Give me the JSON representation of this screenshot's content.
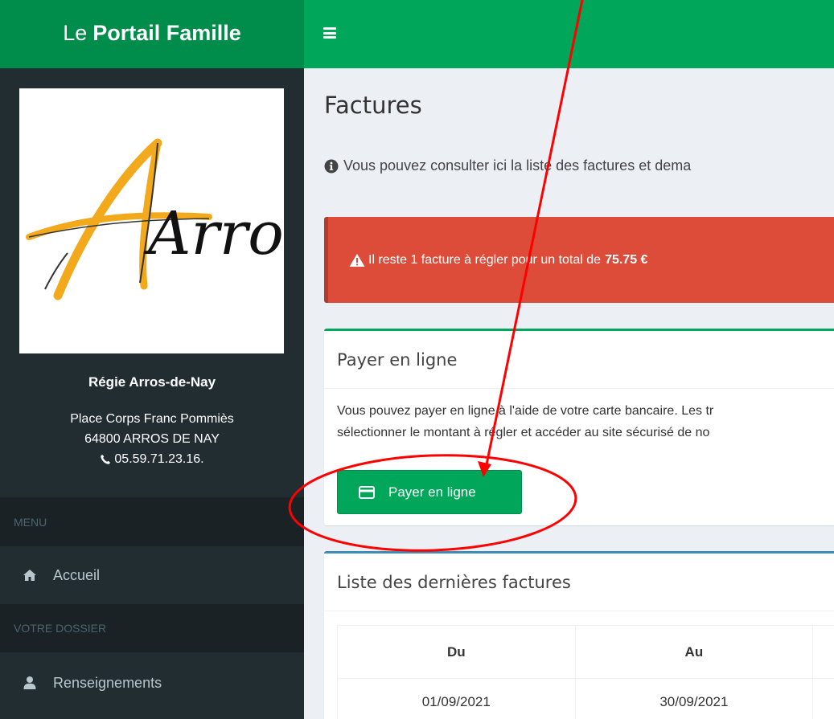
{
  "brand": {
    "prefix": "Le",
    "name": "Portail Famille"
  },
  "sidebar": {
    "logo_text": "Arros",
    "org_name": "Régie Arros-de-Nay",
    "address_line1": "Place Corps Franc Pommiès",
    "address_line2": "64800 ARROS DE NAY",
    "phone": "05.59.71.23.16.",
    "sections": [
      {
        "header": "MENU",
        "items": [
          {
            "label": "Accueil",
            "icon": "home-icon"
          }
        ]
      },
      {
        "header": "VOTRE DOSSIER",
        "items": [
          {
            "label": "Renseignements",
            "icon": "user-icon"
          }
        ]
      }
    ]
  },
  "main": {
    "title": "Factures",
    "info": "Vous pouvez consulter ici la liste des factures et dema",
    "alert": {
      "text": "Il reste 1 facture à régler pour un total de",
      "amount": "75.75 €"
    },
    "pay_box": {
      "title": "Payer en ligne",
      "line1": "Vous pouvez payer en ligne à l'aide de votre carte bancaire. Les tr",
      "line2": "sélectionner le montant à régler et accéder au site sécurisé de no",
      "button_label": "Payer en ligne"
    },
    "invoices_box": {
      "title": "Liste des dernières factures",
      "columns": [
        "Du",
        "Au"
      ],
      "rows": [
        {
          "du": "01/09/2021",
          "au": "30/09/2021"
        }
      ]
    }
  },
  "colors": {
    "brand_dark_green": "#008d4c",
    "topbar_green": "#00a65a",
    "sidebar_bg": "#222d32",
    "alert_red": "#dd4b39",
    "box_blue": "#3c8dbc",
    "annotation_red": "#ff0000"
  }
}
